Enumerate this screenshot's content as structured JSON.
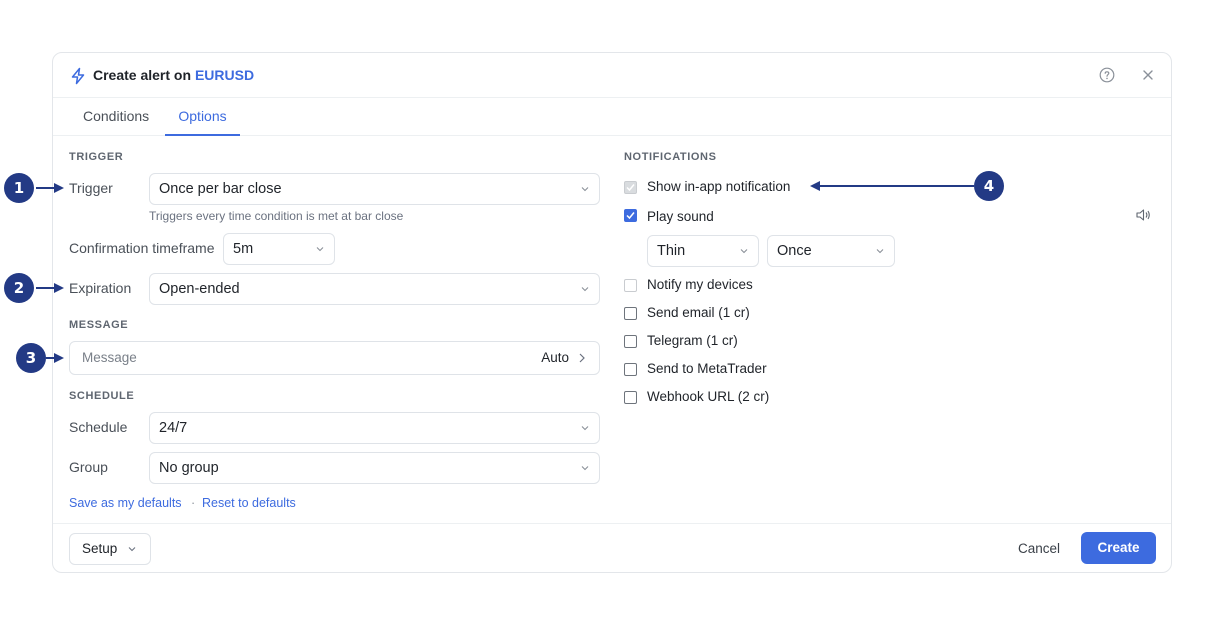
{
  "dialog": {
    "title_prefix": "Create alert on ",
    "symbol": "EURUSD"
  },
  "tabs": [
    {
      "label": "Conditions"
    },
    {
      "label": "Options"
    }
  ],
  "trigger": {
    "section": "TRIGGER",
    "trigger_label": "Trigger",
    "trigger_value": "Once per bar close",
    "trigger_hint": "Triggers every time condition is met at bar close",
    "timeframe_label": "Confirmation timeframe",
    "timeframe_value": "5m",
    "expiration_label": "Expiration",
    "expiration_value": "Open-ended"
  },
  "message": {
    "section": "MESSAGE",
    "placeholder": "Message",
    "mode": "Auto"
  },
  "schedule": {
    "section": "SCHEDULE",
    "schedule_label": "Schedule",
    "schedule_value": "24/7",
    "group_label": "Group",
    "group_value": "No group"
  },
  "defaults": {
    "save": "Save as my defaults",
    "separator": "·",
    "reset": "Reset to defaults"
  },
  "notifications": {
    "section": "NOTIFICATIONS",
    "items": [
      {
        "label": "Show in-app notification",
        "state": "checked-disabled"
      },
      {
        "label": "Play sound",
        "state": "checked"
      },
      {
        "label": "Notify my devices",
        "state": "disabled"
      },
      {
        "label": "Send email (1 cr)",
        "state": "unchecked"
      },
      {
        "label": "Telegram (1 cr)",
        "state": "unchecked"
      },
      {
        "label": "Send to MetaTrader",
        "state": "unchecked"
      },
      {
        "label": "Webhook URL (2 cr)",
        "state": "unchecked"
      }
    ],
    "sound_value": "Thin",
    "repeat_value": "Once"
  },
  "footer": {
    "setup": "Setup",
    "cancel": "Cancel",
    "create": "Create"
  },
  "annotations": [
    "1",
    "2",
    "3",
    "4"
  ],
  "colors": {
    "accent": "#3d6bdf",
    "marker": "#233a85"
  }
}
